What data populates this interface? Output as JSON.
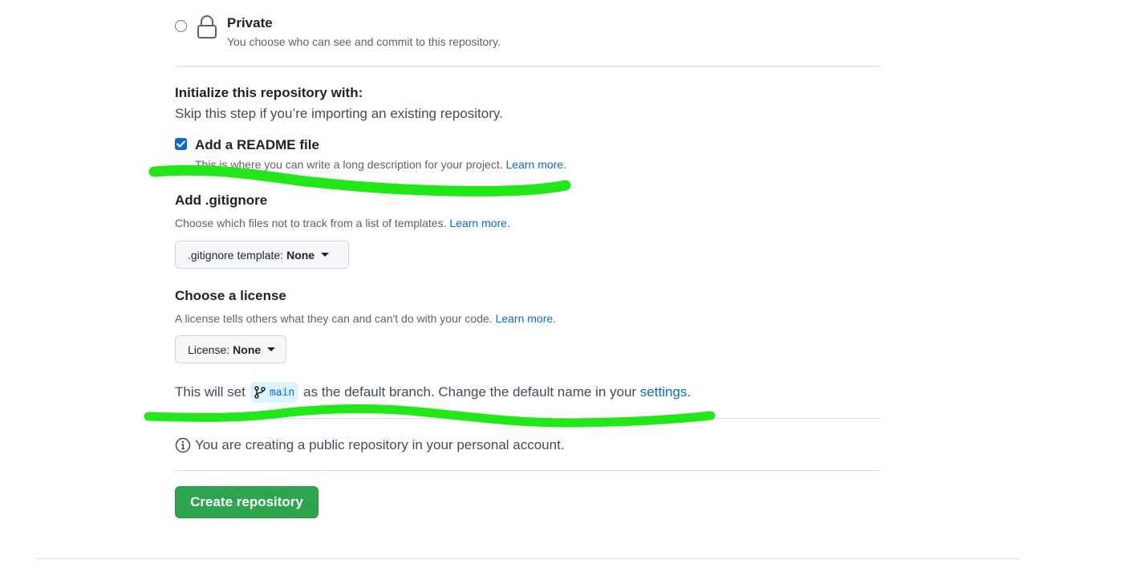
{
  "visibility": {
    "private_label": "Private",
    "private_description": "You choose who can see and commit to this repository."
  },
  "initialize": {
    "title": "Initialize this repository with:",
    "description": "Skip this step if you’re importing an existing repository."
  },
  "readme": {
    "label": "Add a README file",
    "checked": true,
    "description": "This is where you can write a long description for your project.",
    "learn_more": "Learn more."
  },
  "gitignore": {
    "title": "Add .gitignore",
    "description": "Choose which files not to track from a list of templates.",
    "learn_more": "Learn more.",
    "dropdown_label": ".gitignore template:",
    "dropdown_value": "None"
  },
  "license": {
    "title": "Choose a license",
    "description": "A license tells others what they can and can't do with your code.",
    "learn_more": "Learn more.",
    "dropdown_label": "License:",
    "dropdown_value": "None"
  },
  "branch": {
    "prefix": "This will set",
    "branch_name": "main",
    "middle": "as the default branch. Change the default name in your",
    "settings_link": "settings",
    "suffix": "."
  },
  "info": {
    "message": "You are creating a public repository in your personal account."
  },
  "actions": {
    "create_label": "Create repository"
  },
  "colors": {
    "primary_button": "#2da44e",
    "link": "#0969da",
    "checkbox": "#0969da",
    "annotation_scribble": "#22e81a"
  },
  "icons": {
    "visibility": "lock-icon",
    "branch": "git-branch-icon",
    "info": "info-icon"
  }
}
